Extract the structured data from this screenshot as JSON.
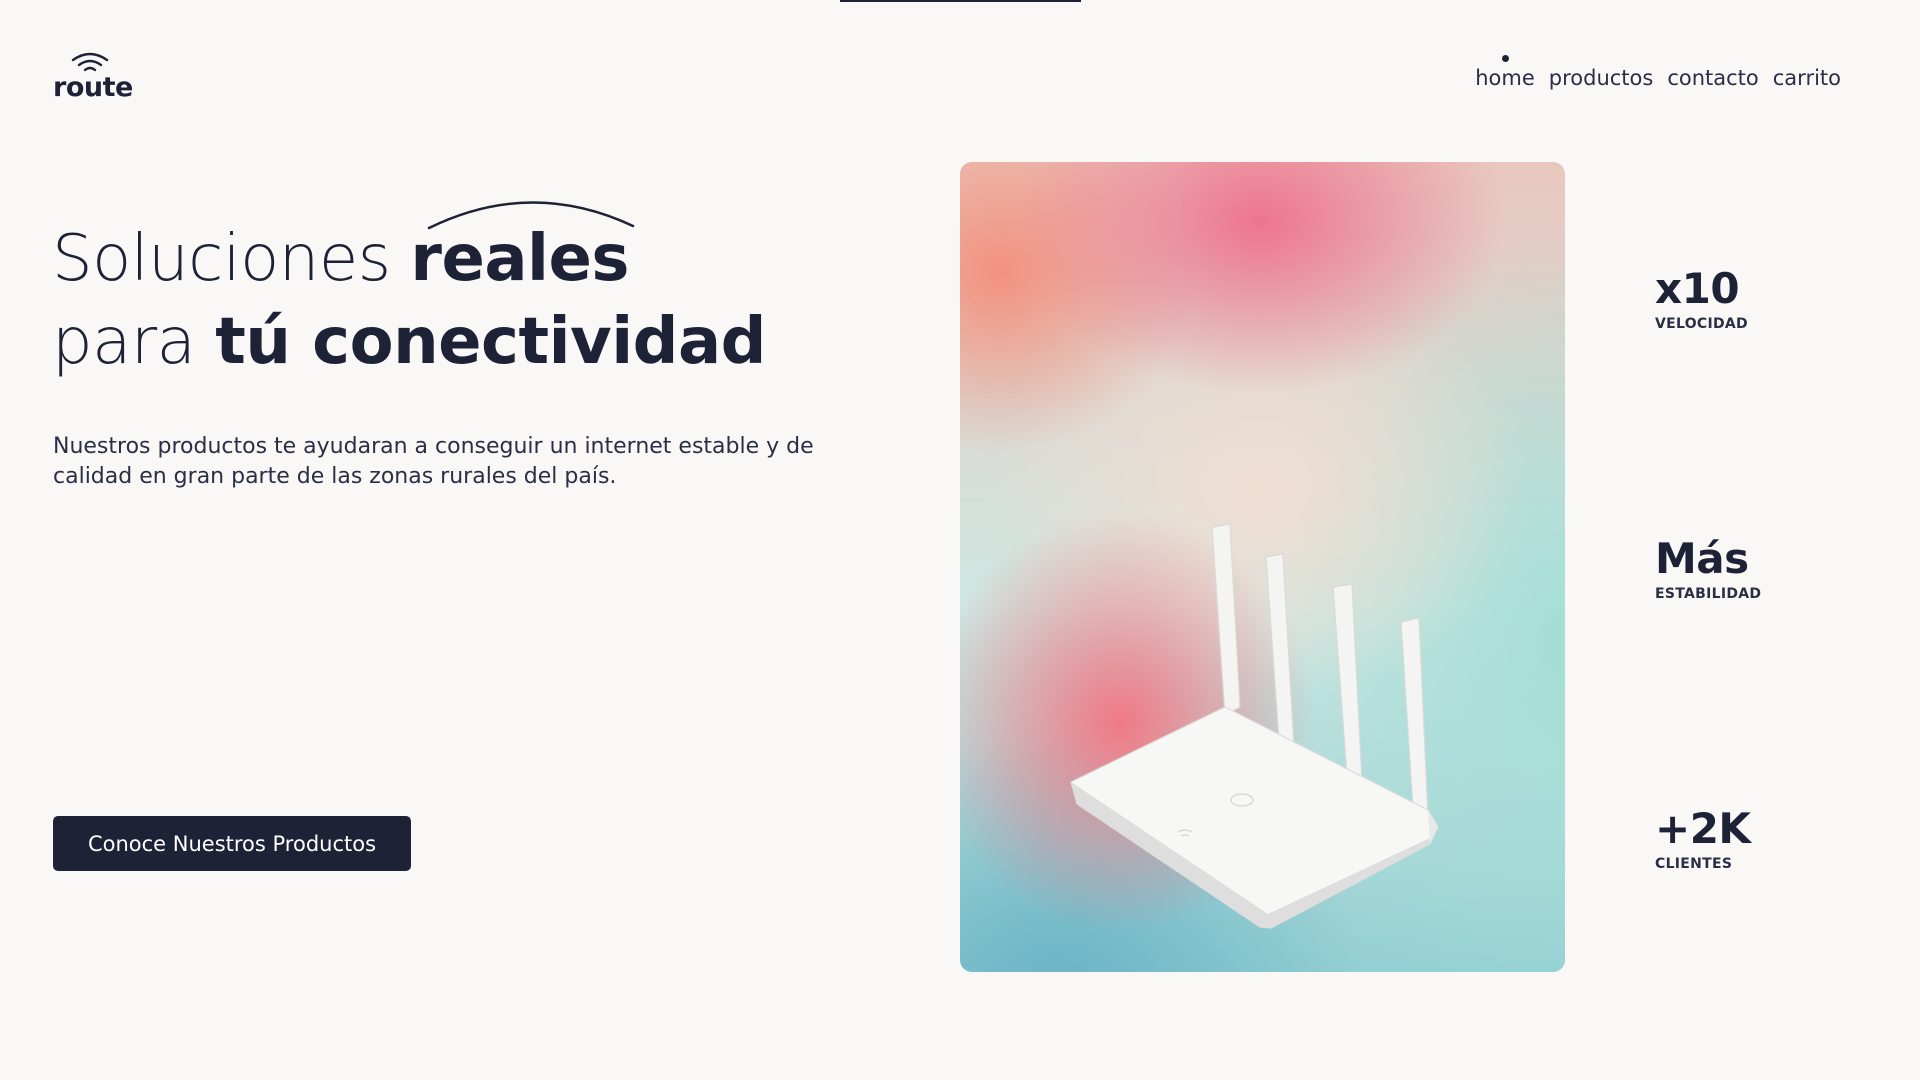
{
  "brand": {
    "name": "route"
  },
  "nav": {
    "active": "home",
    "items": [
      {
        "label": "home"
      },
      {
        "label": "productos"
      },
      {
        "label": "contacto"
      },
      {
        "label": "carrito"
      }
    ]
  },
  "hero": {
    "title_line1_light": "Soluciones ",
    "title_line1_bold": "reales",
    "title_line2_light": "para ",
    "title_line2_bold": "tú conectividad",
    "description": "Nuestros productos te ayudaran a conseguir un internet estable y de calidad en gran parte de las zonas rurales del país.",
    "cta_label": "Conoce Nuestros Productos"
  },
  "stats": [
    {
      "value": "x10",
      "label": "VELOCIDAD"
    },
    {
      "value": "Más",
      "label": "ESTABILIDAD"
    },
    {
      "value": "+2K",
      "label": "CLIENTES"
    }
  ],
  "image": {
    "subject": "router-image",
    "icons": [
      "wifi-icon",
      "router-icon"
    ]
  },
  "colors": {
    "primary": "#1d2236",
    "background": "#f9f8f6",
    "button_text": "#ffffff"
  }
}
